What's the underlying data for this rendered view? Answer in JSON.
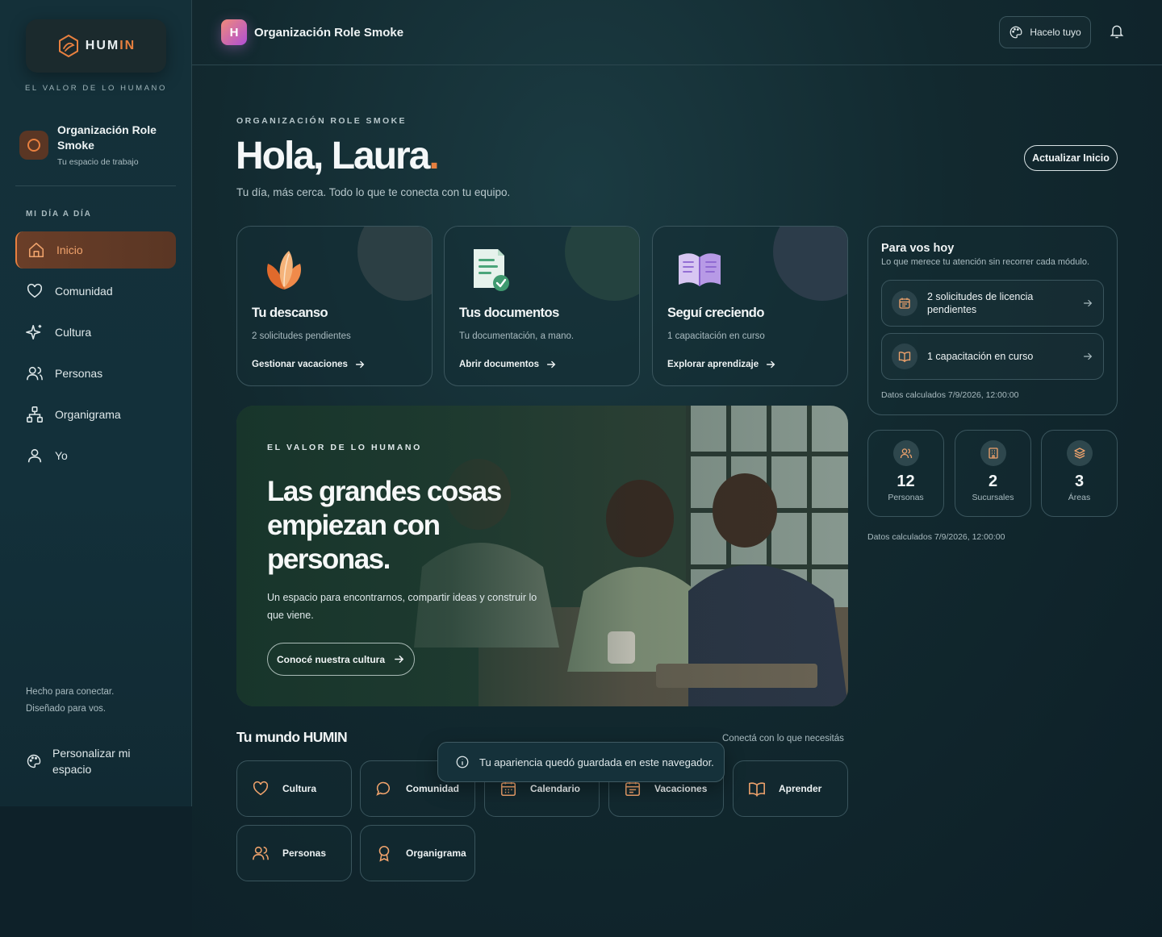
{
  "brand": {
    "logo_text": "HUM",
    "logo_accent": "IN",
    "tagline": "EL VALOR DE LO HUMANO",
    "accent_color": "#e8803f"
  },
  "sidebar": {
    "org_name": "Organización Role Smoke",
    "org_sub": "Tu espacio de trabajo",
    "section_label": "MI DÍA A DÍA",
    "items": [
      {
        "label": "Inicio",
        "icon": "home-icon",
        "active": true
      },
      {
        "label": "Comunidad",
        "icon": "heart-icon"
      },
      {
        "label": "Cultura",
        "icon": "sparkle-icon"
      },
      {
        "label": "Personas",
        "icon": "users-icon"
      },
      {
        "label": "Organigrama",
        "icon": "org-chart-icon"
      },
      {
        "label": "Yo",
        "icon": "user-icon"
      }
    ],
    "footer_line1": "Hecho para conectar.",
    "footer_line2": "Diseñado para vos.",
    "personalize_label": "Personalizar mi espacio"
  },
  "topbar": {
    "org_initial": "H",
    "org_name": "Organización Role Smoke",
    "customize_label": "Hacelo tuyo"
  },
  "hero": {
    "eyebrow": "ORGANIZACIÓN ROLE SMOKE",
    "greeting": "Hola, Laura",
    "greeting_dot": ".",
    "subtitle": "Tu día, más cerca. Todo lo que te conecta con tu equipo.",
    "update_button": "Actualizar Inicio"
  },
  "cards": [
    {
      "title": "Tu descanso",
      "subtitle": "2 solicitudes pendientes",
      "link": "Gestionar vacaciones",
      "icon": "leaf-icon"
    },
    {
      "title": "Tus documentos",
      "subtitle": "Tu documentación, a mano.",
      "link": "Abrir documentos",
      "icon": "document-check-icon"
    },
    {
      "title": "Seguí creciendo",
      "subtitle": "1 capacitación en curso",
      "link": "Explorar aprendizaje",
      "icon": "book-icon"
    }
  ],
  "banner": {
    "eyebrow": "EL VALOR DE LO HUMANO",
    "title": "Las grandes cosas empiezan con personas.",
    "text": "Un espacio para encontrarnos, compartir ideas y construir lo que viene.",
    "button": "Conocé nuestra cultura"
  },
  "panel": {
    "title": "Para vos hoy",
    "subtitle": "Lo que merece tu atención sin recorrer cada módulo.",
    "items": [
      {
        "text": "2 solicitudes de licencia pendientes",
        "icon": "calendar-icon"
      },
      {
        "text": "1 capacitación en curso",
        "icon": "book-open-icon"
      }
    ],
    "footer": "Datos calculados 7/9/2026, 12:00:00"
  },
  "stats": [
    {
      "value": "12",
      "label": "Personas",
      "icon": "users-icon"
    },
    {
      "value": "2",
      "label": "Sucursales",
      "icon": "building-icon"
    },
    {
      "value": "3",
      "label": "Áreas",
      "icon": "layers-icon"
    }
  ],
  "stats_footer": "Datos calculados 7/9/2026, 12:00:00",
  "mundo": {
    "title": "Tu mundo HUMIN",
    "subtitle": "Conectá con lo que necesitás",
    "tiles": [
      {
        "label": "Cultura",
        "icon": "heart-icon"
      },
      {
        "label": "Comunidad",
        "icon": "chat-icon"
      },
      {
        "label": "Calendario",
        "icon": "calendar-icon"
      },
      {
        "label": "Vacaciones",
        "icon": "calendar-list-icon"
      },
      {
        "label": "Aprender",
        "icon": "book-open-icon"
      },
      {
        "label": "Personas",
        "icon": "users-icon"
      },
      {
        "label": "Organigrama",
        "icon": "award-icon"
      }
    ]
  },
  "toast": {
    "text": "Tu apariencia quedó guardada en este navegador."
  }
}
